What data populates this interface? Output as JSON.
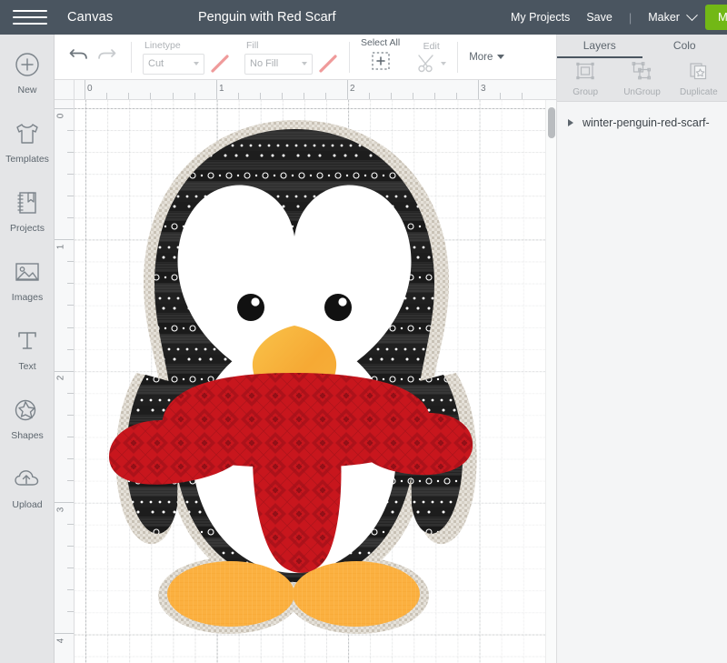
{
  "topbar": {
    "menu_icon": "hamburger-icon",
    "canvas_label": "Canvas",
    "project_title": "Penguin with Red Scarf",
    "my_projects_label": "My Projects",
    "save_label": "Save",
    "separator": "|",
    "machine_label": "Maker",
    "make_it_label": "Ma",
    "bar_color": "#4a5560",
    "make_button_color": "#72b816"
  },
  "sidebar": {
    "items": [
      {
        "label": "New",
        "icon": "plus-circle-icon"
      },
      {
        "label": "Templates",
        "icon": "tshirt-icon"
      },
      {
        "label": "Projects",
        "icon": "notebook-icon"
      },
      {
        "label": "Images",
        "icon": "picture-icon"
      },
      {
        "label": "Text",
        "icon": "text-t-icon"
      },
      {
        "label": "Shapes",
        "icon": "star-shape-icon"
      },
      {
        "label": "Upload",
        "icon": "cloud-upload-icon"
      }
    ]
  },
  "toolbar": {
    "undo_icon": "undo-arrow-icon",
    "redo_icon": "redo-arrow-icon",
    "linetype": {
      "label": "Linetype",
      "value": "Cut",
      "swatch_icon": "diagonal-line-swatch",
      "swatch_color": "#ef9a9a"
    },
    "fill": {
      "label": "Fill",
      "value": "No Fill",
      "swatch_icon": "diagonal-line-swatch",
      "swatch_color": "#ef9a9a"
    },
    "select_all": {
      "label": "Select All",
      "icon": "dashed-square-plus-icon"
    },
    "edit": {
      "label": "Edit",
      "icon": "scissors-icon"
    },
    "more": {
      "label": "More",
      "icon": "caret-down-icon"
    }
  },
  "rulers": {
    "horizontal": {
      "ticks": [
        "0",
        "1",
        "2",
        "3"
      ],
      "unit": "in"
    },
    "vertical": {
      "ticks": [
        "0",
        "1",
        "2",
        "3",
        "4"
      ],
      "unit": "in"
    }
  },
  "right_panel": {
    "tabs": [
      {
        "label": "Layers",
        "active": true
      },
      {
        "label": "Colo",
        "active": false
      }
    ],
    "actions": [
      {
        "label": "Group",
        "icon": "group-icon"
      },
      {
        "label": "UnGroup",
        "icon": "ungroup-icon"
      },
      {
        "label": "Duplicate",
        "icon": "duplicate-icon"
      }
    ],
    "layers": [
      {
        "name": "winter-penguin-red-scarf-",
        "expanded": false,
        "twisty_icon": "triangle-right-icon"
      }
    ]
  },
  "artwork": {
    "name": "penguin-with-red-scarf",
    "colors": {
      "outline_beige": "#d6d0c6",
      "body_black": "#2b2b2b",
      "body_dark": "#1f1f1f",
      "belly_white": "#ffffff",
      "beak_orange": "#f6b43c",
      "beak_orange_dark": "#f08c34",
      "feet_orange": "#fbb040",
      "scarf_red": "#c8161d",
      "scarf_red_dark": "#9e0f16",
      "eye_black": "#111111"
    }
  }
}
